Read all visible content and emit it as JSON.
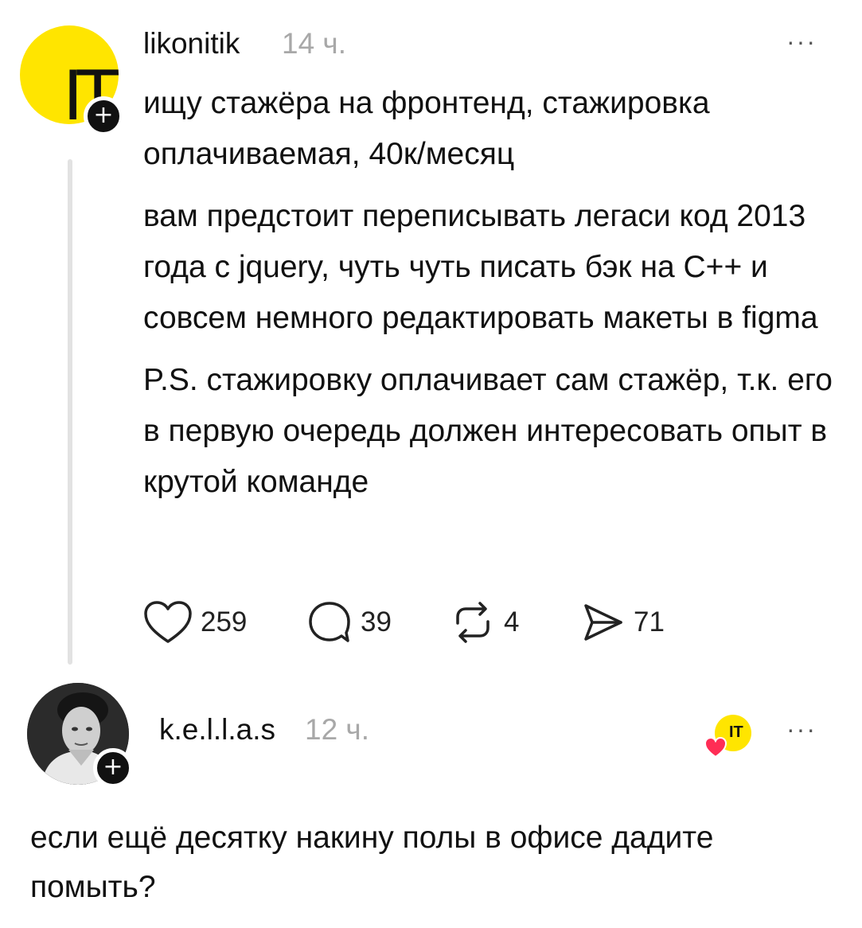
{
  "post": {
    "author": {
      "username": "likonitik",
      "time": "14 ч.",
      "avatar_text": "IT",
      "avatar_color": "#ffe500"
    },
    "follow_symbol": "+",
    "more_label": "···",
    "paragraphs": [
      "ищу стажёра на фронтенд, стажировка оплачиваемая, 40к/месяц",
      "вам предстоит переписывать легаси код 2013 года с jquery, чуть чуть писать бэк на С++ и совсем немного редактировать макеты в figma",
      "P.S. стажировку оплачивает сам стажёр, т.к. его в первую очередь должен интересовать опыт в крутой команде"
    ],
    "actions": {
      "likes": "259",
      "comments": "39",
      "reposts": "4",
      "shares": "71"
    }
  },
  "reply": {
    "author": {
      "username": "k.e.l.l.a.s",
      "time": "12 ч."
    },
    "follow_symbol": "+",
    "liked_by_author_badge": "IT",
    "more_label": "···",
    "text": "если ещё десятку накину полы в офисе дадите помыть?"
  },
  "colors": {
    "accent_yellow": "#ffe500",
    "heart_red": "#ff2d55",
    "muted_text": "#a8a8a8"
  },
  "icons": {
    "like": "heart-icon",
    "comment": "comment-bubble-icon",
    "repost": "repost-arrows-icon",
    "share": "send-icon",
    "more": "more-dots-icon",
    "follow": "plus-icon"
  }
}
